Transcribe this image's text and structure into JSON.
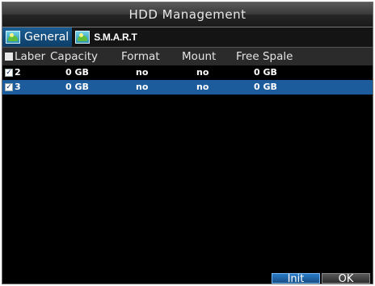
{
  "window": {
    "title": "HDD Management"
  },
  "tabs": [
    {
      "label": "General",
      "icon": "landscape-icon",
      "active": true
    },
    {
      "label": "S.M.A.R.T",
      "icon": "landscape-icon",
      "active": false
    }
  ],
  "table": {
    "columns": [
      "Laber",
      "Capacity",
      "Format",
      "Mount",
      "Free Spale"
    ],
    "rows": [
      {
        "checked": true,
        "label": "2",
        "capacity": "0 GB",
        "format": "no",
        "mount": "no",
        "free_space": "0 GB",
        "selected": false
      },
      {
        "checked": true,
        "label": "3",
        "capacity": "0 GB",
        "format": "no",
        "mount": "no",
        "free_space": "0 GB",
        "selected": true
      }
    ]
  },
  "buttons": {
    "init": "Init",
    "ok": "OK"
  },
  "colors": {
    "selection": "#1c5c9c",
    "active_tab": "#1b5e94",
    "background": "#000000"
  }
}
